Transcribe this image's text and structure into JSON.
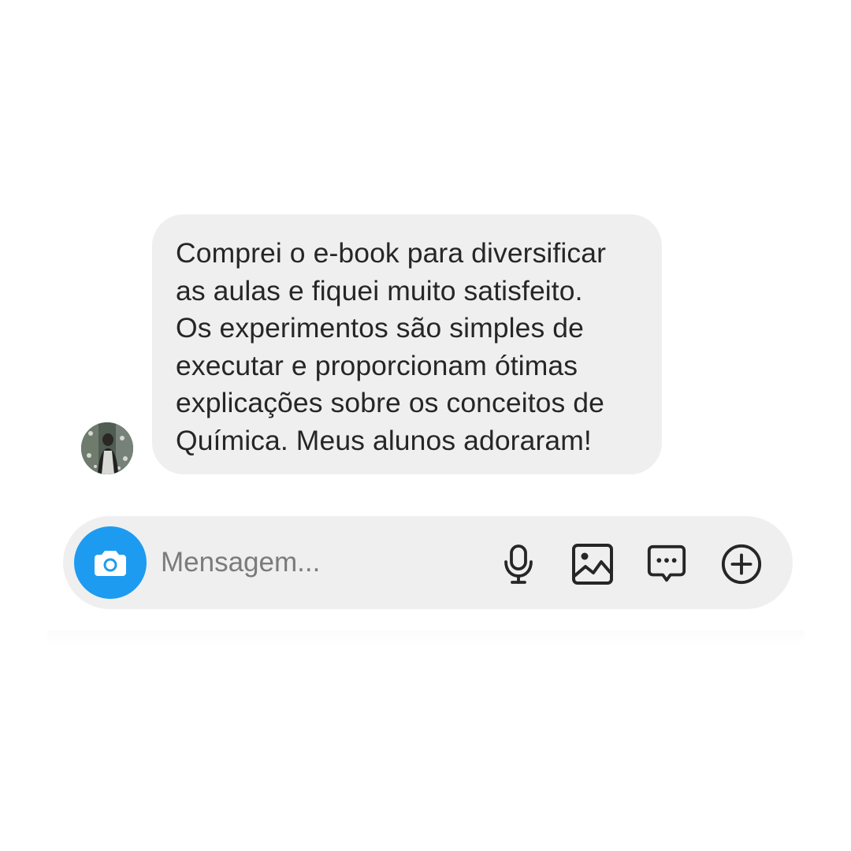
{
  "conversation": {
    "message": {
      "text": "Comprei o e-book para diversificar as aulas e fiquei muito satisfeito. Os experimentos são simples de executar e proporcionam ótimas explicações sobre os conceitos de Química. Meus alunos adoraram!",
      "lines": [
        "Comprei o e-book para diversificar",
        "as aulas e fiquei muito satisfeito.",
        "Os experimentos são simples de",
        "executar e proporcionam ótimas",
        "explicações sobre os conceitos de",
        "Química. Meus alunos adoraram!"
      ]
    }
  },
  "composer": {
    "placeholder": "Mensagem...",
    "icons": [
      "camera-icon",
      "microphone-icon",
      "gallery-icon",
      "sticker-icon",
      "plus-circle-icon"
    ]
  },
  "colors": {
    "bubble_background": "#efefef",
    "camera_button": "#1d9bf0",
    "text": "#262626",
    "placeholder": "#7b7b7b"
  }
}
